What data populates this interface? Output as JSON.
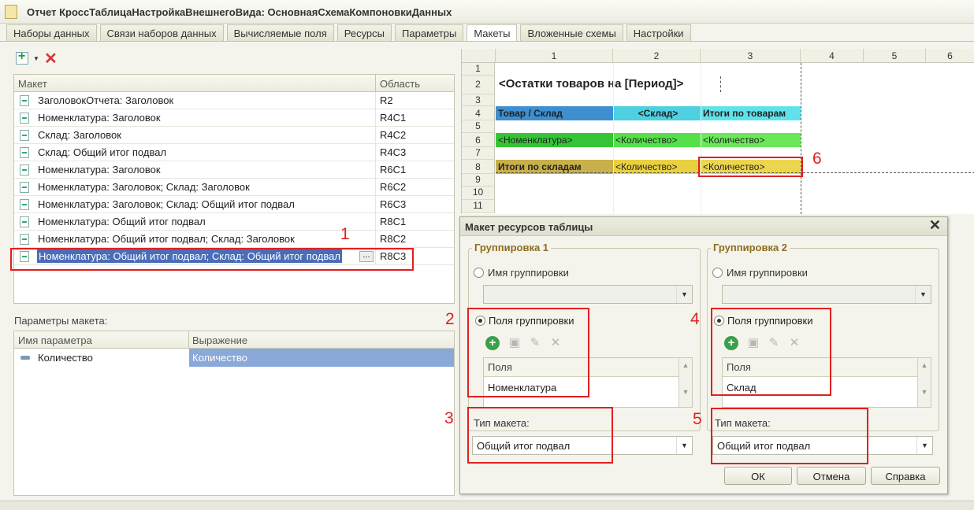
{
  "window": {
    "title": "Отчет КроссТаблицаНастройкаВнешнегоВида: ОсновнаяСхемаКомпоновкиДанных"
  },
  "tabs": [
    {
      "label": "Наборы данных"
    },
    {
      "label": "Связи наборов данных"
    },
    {
      "label": "Вычисляемые поля"
    },
    {
      "label": "Ресурсы"
    },
    {
      "label": "Параметры"
    },
    {
      "label": "Макеты",
      "active": true
    },
    {
      "label": "Вложенные схемы"
    },
    {
      "label": "Настройки"
    }
  ],
  "layouts": {
    "headers": {
      "layout": "Макет",
      "area": "Область"
    },
    "rows": [
      {
        "name": "ЗаголовокОтчета: Заголовок",
        "area": "R2"
      },
      {
        "name": "Номенклатура: Заголовок",
        "area": "R4C1"
      },
      {
        "name": "Склад: Заголовок",
        "area": "R4C2"
      },
      {
        "name": "Склад: Общий итог подвал",
        "area": "R4C3"
      },
      {
        "name": "Номенклатура: Заголовок",
        "area": "R6C1"
      },
      {
        "name": "Номенклатура: Заголовок; Склад: Заголовок",
        "area": "R6C2"
      },
      {
        "name": "Номенклатура: Заголовок; Склад: Общий итог подвал",
        "area": "R6C3"
      },
      {
        "name": "Номенклатура: Общий итог подвал",
        "area": "R8C1"
      },
      {
        "name": "Номенклатура: Общий итог подвал; Склад: Заголовок",
        "area": "R8C2"
      },
      {
        "name": "Номенклатура: Общий итог подвал; Склад: Общий итог подвал",
        "area": "R8C3",
        "selected": true
      }
    ]
  },
  "params": {
    "title": "Параметры макета:",
    "headers": {
      "name": "Имя параметра",
      "expr": "Выражение"
    },
    "rows": [
      {
        "name": "Количество",
        "expr": "Количество"
      }
    ]
  },
  "sheet": {
    "columns": [
      "1",
      "2",
      "3",
      "4",
      "5",
      "6"
    ],
    "rows": [
      "1",
      "2",
      "3",
      "4",
      "5",
      "6",
      "7",
      "8",
      "9",
      "10",
      "11"
    ],
    "cells": {
      "r2": "<Остатки товаров на [Период]>",
      "r4c1": "Товар / Склад",
      "r4c2": "<Склад>",
      "r4c3": "Итоги по товарам",
      "r6c1": "<Номенклатура>",
      "r6c2": "<Количество>",
      "r6c3": "<Количество>",
      "r8c1": "Итоги по складам",
      "r8c2": "<Количество>",
      "r8c3": "<Количество>"
    },
    "colors": {
      "header": "#3d8fd0",
      "header2": "#4dd0e0",
      "green": "#35c435",
      "green2": "#55e04a",
      "olive": "#c8b04a",
      "yellow": "#e8d040"
    }
  },
  "dialog": {
    "title": "Макет ресурсов таблицы",
    "group1": {
      "title": "Группировка 1",
      "name_option": "Имя группировки",
      "fields_option": "Поля группировки",
      "fields_header": "Поля",
      "field_value": "Номенклатура",
      "type_label": "Тип макета:",
      "type_value": "Общий итог подвал"
    },
    "group2": {
      "title": "Группировка 2",
      "name_option": "Имя группировки",
      "fields_option": "Поля группировки",
      "fields_header": "Поля",
      "field_value": "Склад",
      "type_label": "Тип макета:",
      "type_value": "Общий итог подвал"
    },
    "buttons": {
      "ok": "ОК",
      "cancel": "Отмена",
      "help": "Справка"
    }
  },
  "annotations": [
    "1",
    "2",
    "3",
    "4",
    "5",
    "6"
  ]
}
